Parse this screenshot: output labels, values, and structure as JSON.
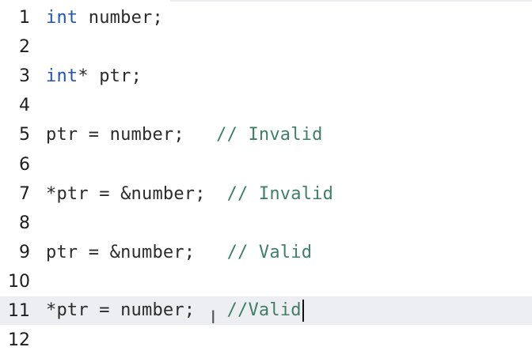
{
  "editor": {
    "lines": [
      {
        "number": "1",
        "segments": [
          {
            "type": "keyword",
            "text": "int"
          },
          {
            "type": "text",
            "text": " number;"
          }
        ]
      },
      {
        "number": "2",
        "segments": []
      },
      {
        "number": "3",
        "segments": [
          {
            "type": "keyword",
            "text": "int"
          },
          {
            "type": "text",
            "text": "* ptr;"
          }
        ]
      },
      {
        "number": "4",
        "segments": []
      },
      {
        "number": "5",
        "segments": [
          {
            "type": "text",
            "text": "ptr = number;   "
          },
          {
            "type": "comment",
            "text": "// Invalid"
          }
        ]
      },
      {
        "number": "6",
        "segments": []
      },
      {
        "number": "7",
        "segments": [
          {
            "type": "text",
            "text": "*ptr = &number;  "
          },
          {
            "type": "comment",
            "text": "// Invalid"
          }
        ]
      },
      {
        "number": "8",
        "segments": []
      },
      {
        "number": "9",
        "segments": [
          {
            "type": "text",
            "text": "ptr = &number;   "
          },
          {
            "type": "comment",
            "text": "// Valid"
          }
        ]
      },
      {
        "number": "10",
        "segments": []
      },
      {
        "number": "11",
        "segments": [
          {
            "type": "text",
            "text": "*ptr = number;   "
          },
          {
            "type": "comment",
            "text": "//Valid"
          }
        ],
        "current": true,
        "caret": true
      },
      {
        "number": "12",
        "segments": []
      }
    ],
    "colors": {
      "keyword": "#1f53c2",
      "comment": "#3f7f67",
      "text": "#2b2b2b",
      "current_line": "#eceef2"
    }
  }
}
